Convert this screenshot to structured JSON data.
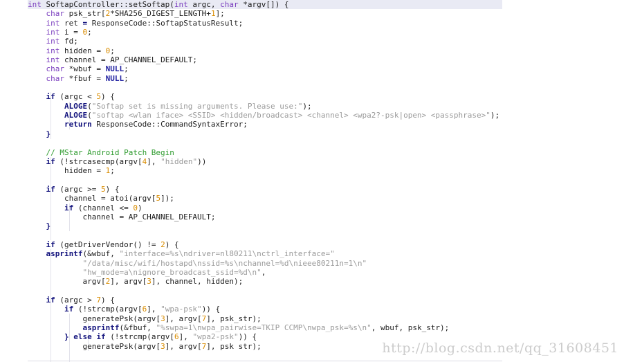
{
  "editor": {
    "language": "cpp",
    "theme": "light",
    "font_size_px": 11,
    "line_height_px": 13.35,
    "colors": {
      "background": "#ffffff",
      "foreground": "#202020",
      "keyword_type": "#7b3fbf",
      "keyword_control": "#13137d",
      "number": "#d98c00",
      "string": "#9a9a9a",
      "comment": "#2e9b2e",
      "constant": "#2020a0",
      "current_line_highlight": "#e9eaf4",
      "indent_guide": "#e2e2ea",
      "watermark": "#cccccc"
    },
    "current_line_index": 0,
    "indent_guide_columns": [
      1,
      2,
      3
    ]
  },
  "watermark": {
    "text": "http://blog.csdn.net/qq_31608451"
  },
  "code": {
    "lines": [
      [
        {
          "t": "int",
          "c": "kw"
        },
        {
          "t": " SoftapController::setSoftap(",
          "c": "id"
        },
        {
          "t": "int",
          "c": "kw"
        },
        {
          "t": " argc, ",
          "c": "id"
        },
        {
          "t": "char",
          "c": "kw"
        },
        {
          "t": " *argv[]) {",
          "c": "id"
        }
      ],
      [
        {
          "t": "    ",
          "c": "id"
        },
        {
          "t": "char",
          "c": "kw"
        },
        {
          "t": " psk_str[",
          "c": "id"
        },
        {
          "t": "2",
          "c": "num"
        },
        {
          "t": "*SHA256_DIGEST_LENGTH+",
          "c": "id"
        },
        {
          "t": "1",
          "c": "num"
        },
        {
          "t": "];",
          "c": "id"
        }
      ],
      [
        {
          "t": "    ",
          "c": "id"
        },
        {
          "t": "int",
          "c": "kw"
        },
        {
          "t": " ret ",
          "c": "id"
        },
        {
          "t": "=",
          "c": "ctl"
        },
        {
          "t": " ResponseCode::SoftapStatusResult;",
          "c": "id"
        }
      ],
      [
        {
          "t": "    ",
          "c": "id"
        },
        {
          "t": "int",
          "c": "kw"
        },
        {
          "t": " i = ",
          "c": "id"
        },
        {
          "t": "0",
          "c": "num"
        },
        {
          "t": ";",
          "c": "id"
        }
      ],
      [
        {
          "t": "    ",
          "c": "id"
        },
        {
          "t": "int",
          "c": "kw"
        },
        {
          "t": " fd;",
          "c": "id"
        }
      ],
      [
        {
          "t": "    ",
          "c": "id"
        },
        {
          "t": "int",
          "c": "kw"
        },
        {
          "t": " hidden = ",
          "c": "id"
        },
        {
          "t": "0",
          "c": "num"
        },
        {
          "t": ";",
          "c": "id"
        }
      ],
      [
        {
          "t": "    ",
          "c": "id"
        },
        {
          "t": "int",
          "c": "kw"
        },
        {
          "t": " channel = AP_CHANNEL_DEFAULT;",
          "c": "id"
        }
      ],
      [
        {
          "t": "    ",
          "c": "id"
        },
        {
          "t": "char",
          "c": "kw"
        },
        {
          "t": " *wbuf = ",
          "c": "id"
        },
        {
          "t": "NULL",
          "c": "cnst"
        },
        {
          "t": ";",
          "c": "id"
        }
      ],
      [
        {
          "t": "    ",
          "c": "id"
        },
        {
          "t": "char",
          "c": "kw"
        },
        {
          "t": " *fbuf = ",
          "c": "id"
        },
        {
          "t": "NULL",
          "c": "cnst"
        },
        {
          "t": ";",
          "c": "id"
        }
      ],
      [],
      [
        {
          "t": "    ",
          "c": "id"
        },
        {
          "t": "if",
          "c": "ctl"
        },
        {
          "t": " (argc < ",
          "c": "id"
        },
        {
          "t": "5",
          "c": "num"
        },
        {
          "t": ") {",
          "c": "id"
        }
      ],
      [
        {
          "t": "        ",
          "c": "id"
        },
        {
          "t": "ALOGE",
          "c": "fn"
        },
        {
          "t": "(",
          "c": "id"
        },
        {
          "t": "\"Softap set is missing arguments. Please use:\"",
          "c": "str"
        },
        {
          "t": ");",
          "c": "id"
        }
      ],
      [
        {
          "t": "        ",
          "c": "id"
        },
        {
          "t": "ALOGE",
          "c": "fn"
        },
        {
          "t": "(",
          "c": "id"
        },
        {
          "t": "\"softap <wlan iface> <SSID> <hidden/broadcast> <channel> <wpa2?-psk|open> <passphrase>\"",
          "c": "str"
        },
        {
          "t": ");",
          "c": "id"
        }
      ],
      [
        {
          "t": "        ",
          "c": "id"
        },
        {
          "t": "return",
          "c": "ctl"
        },
        {
          "t": " ResponseCode::CommandSyntaxError;",
          "c": "id"
        }
      ],
      [
        {
          "t": "    }",
          "c": "ctl"
        }
      ],
      [],
      [
        {
          "t": "    // MStar Android Patch Begin",
          "c": "cmt"
        }
      ],
      [
        {
          "t": "    ",
          "c": "id"
        },
        {
          "t": "if",
          "c": "ctl"
        },
        {
          "t": " (!strcasecmp(argv[",
          "c": "id"
        },
        {
          "t": "4",
          "c": "num"
        },
        {
          "t": "], ",
          "c": "id"
        },
        {
          "t": "\"hidden\"",
          "c": "str"
        },
        {
          "t": "))",
          "c": "id"
        }
      ],
      [
        {
          "t": "        hidden = ",
          "c": "id"
        },
        {
          "t": "1",
          "c": "num"
        },
        {
          "t": ";",
          "c": "id"
        }
      ],
      [],
      [
        {
          "t": "    ",
          "c": "id"
        },
        {
          "t": "if",
          "c": "ctl"
        },
        {
          "t": " (argc >= ",
          "c": "id"
        },
        {
          "t": "5",
          "c": "num"
        },
        {
          "t": ") {",
          "c": "id"
        }
      ],
      [
        {
          "t": "        channel = atoi(argv[",
          "c": "id"
        },
        {
          "t": "5",
          "c": "num"
        },
        {
          "t": "]);",
          "c": "id"
        }
      ],
      [
        {
          "t": "        ",
          "c": "id"
        },
        {
          "t": "if",
          "c": "ctl"
        },
        {
          "t": " (channel <= ",
          "c": "id"
        },
        {
          "t": "0",
          "c": "num"
        },
        {
          "t": ")",
          "c": "id"
        }
      ],
      [
        {
          "t": "            channel = AP_CHANNEL_DEFAULT;",
          "c": "id"
        }
      ],
      [
        {
          "t": "    }",
          "c": "ctl"
        }
      ],
      [],
      [
        {
          "t": "    ",
          "c": "id"
        },
        {
          "t": "if",
          "c": "ctl"
        },
        {
          "t": " (getDriverVendor() != ",
          "c": "id"
        },
        {
          "t": "2",
          "c": "num"
        },
        {
          "t": ") {",
          "c": "id"
        }
      ],
      [
        {
          "t": "    ",
          "c": "id"
        },
        {
          "t": "asprintf",
          "c": "fn"
        },
        {
          "t": "(&wbuf, ",
          "c": "id"
        },
        {
          "t": "\"interface=%s\\ndriver=nl80211\\nctrl_interface=\"",
          "c": "str"
        }
      ],
      [
        {
          "t": "            ",
          "c": "id"
        },
        {
          "t": "\"/data/misc/wifi/hostapd\\nssid=%s\\nchannel=%d\\nieee80211n=1\\n\"",
          "c": "str"
        }
      ],
      [
        {
          "t": "            ",
          "c": "id"
        },
        {
          "t": "\"hw_mode=a\\nignore_broadcast_ssid=%d\\n\"",
          "c": "str"
        },
        {
          "t": ",",
          "c": "id"
        }
      ],
      [
        {
          "t": "            argv[",
          "c": "id"
        },
        {
          "t": "2",
          "c": "num"
        },
        {
          "t": "], argv[",
          "c": "id"
        },
        {
          "t": "3",
          "c": "num"
        },
        {
          "t": "], channel, hidden);",
          "c": "id"
        }
      ],
      [],
      [
        {
          "t": "    ",
          "c": "id"
        },
        {
          "t": "if",
          "c": "ctl"
        },
        {
          "t": " (argc > ",
          "c": "id"
        },
        {
          "t": "7",
          "c": "num"
        },
        {
          "t": ") {",
          "c": "id"
        }
      ],
      [
        {
          "t": "        ",
          "c": "id"
        },
        {
          "t": "if",
          "c": "ctl"
        },
        {
          "t": " (!strcmp(argv[",
          "c": "id"
        },
        {
          "t": "6",
          "c": "num"
        },
        {
          "t": "], ",
          "c": "id"
        },
        {
          "t": "\"wpa-psk\"",
          "c": "str"
        },
        {
          "t": ")) {",
          "c": "id"
        }
      ],
      [
        {
          "t": "            generatePsk(argv[",
          "c": "id"
        },
        {
          "t": "3",
          "c": "num"
        },
        {
          "t": "], argv[",
          "c": "id"
        },
        {
          "t": "7",
          "c": "num"
        },
        {
          "t": "], psk_str);",
          "c": "id"
        }
      ],
      [
        {
          "t": "            ",
          "c": "id"
        },
        {
          "t": "asprintf",
          "c": "fn"
        },
        {
          "t": "(&fbuf, ",
          "c": "id"
        },
        {
          "t": "\"%swpa=1\\nwpa_pairwise=TKIP CCMP\\nwpa_psk=%s\\n\"",
          "c": "str"
        },
        {
          "t": ", wbuf, psk_str);",
          "c": "id"
        }
      ],
      [
        {
          "t": "        } ",
          "c": "ctl"
        },
        {
          "t": "else",
          "c": "ctl"
        },
        {
          "t": " ",
          "c": "id"
        },
        {
          "t": "if",
          "c": "ctl"
        },
        {
          "t": " (!strcmp(argv[",
          "c": "id"
        },
        {
          "t": "6",
          "c": "num"
        },
        {
          "t": "], ",
          "c": "id"
        },
        {
          "t": "\"wpa2-psk\"",
          "c": "str"
        },
        {
          "t": ")) {",
          "c": "id"
        }
      ],
      [
        {
          "t": "            generatePsk(argv[",
          "c": "id"
        },
        {
          "t": "3",
          "c": "num"
        },
        {
          "t": "], argv[",
          "c": "id"
        },
        {
          "t": "7",
          "c": "num"
        },
        {
          "t": "], psk str);",
          "c": "id"
        }
      ]
    ]
  }
}
